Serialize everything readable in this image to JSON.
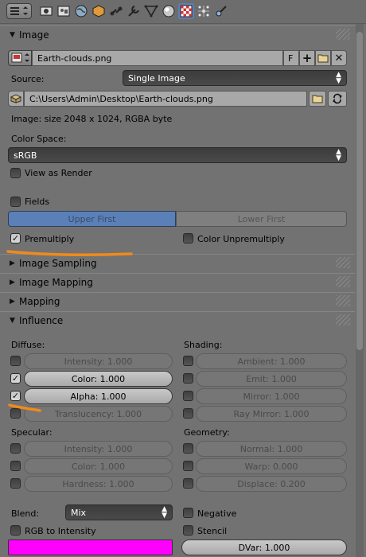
{
  "toolbar": {
    "buttons": [
      {
        "icon": "render-icon"
      },
      {
        "icon": "scene-icon"
      },
      {
        "icon": "world-icon"
      },
      {
        "icon": "object-icon"
      },
      {
        "icon": "constraints-icon"
      },
      {
        "icon": "modifiers-icon"
      },
      {
        "icon": "object-data-icon"
      },
      {
        "icon": "material-icon"
      },
      {
        "icon": "texture-icon"
      },
      {
        "icon": "particles-icon"
      },
      {
        "icon": "physics-icon"
      }
    ],
    "active_icon": "texture-icon"
  },
  "image_panel": {
    "title": "Image",
    "image_name": "Earth-clouds.png",
    "fake_user": "F",
    "source_label": "Source:",
    "source_value": "Single Image",
    "filepath": "C:\\Users\\Admin\\Desktop\\Earth-clouds.png",
    "info": "Image: size 2048 x 1024, RGBA byte",
    "color_space_label": "Color Space:",
    "color_space_value": "sRGB",
    "view_as_render": "View as Render",
    "fields": "Fields",
    "upper_first": "Upper First",
    "lower_first": "Lower First",
    "premultiply": "Premultiply",
    "color_unpremultiply": "Color Unpremultiply"
  },
  "collapsed_panels": [
    "Image Sampling",
    "Image Mapping",
    "Mapping"
  ],
  "influence": {
    "title": "Influence",
    "diffuse_label": "Diffuse:",
    "shading_label": "Shading:",
    "diffuse": [
      {
        "label": "Intensity: 1.000",
        "checked": false
      },
      {
        "label": "Color: 1.000",
        "checked": true
      },
      {
        "label": "Alpha: 1.000",
        "checked": true
      },
      {
        "label": "Translucency: 1.000",
        "checked": false
      }
    ],
    "shading": [
      {
        "label": "Ambient: 1.000",
        "checked": false
      },
      {
        "label": "Emit: 1.000",
        "checked": false
      },
      {
        "label": "Mirror: 1.000",
        "checked": false
      },
      {
        "label": "Ray Mirror: 1.000",
        "checked": false
      }
    ],
    "specular_label": "Specular:",
    "geometry_label": "Geometry:",
    "specular": [
      {
        "label": "Intensity: 1.000",
        "checked": false
      },
      {
        "label": "Color: 1.000",
        "checked": false
      },
      {
        "label": "Hardness: 1.000",
        "checked": false
      }
    ],
    "geometry": [
      {
        "label": "Normal: 1.000",
        "checked": false
      },
      {
        "label": "Warp: 0.000",
        "checked": false
      },
      {
        "label": "Displace: 0.200",
        "checked": false
      }
    ],
    "blend_label": "Blend:",
    "blend_value": "Mix",
    "negative": "Negative",
    "rgb_to_intensity": "RGB to Intensity",
    "stencil": "Stencil",
    "dvar": "DVar: 1.000",
    "color_swatch": "#ff00ff"
  },
  "accent_color": "#5b80b8",
  "annotation_color": "#f08a1c"
}
